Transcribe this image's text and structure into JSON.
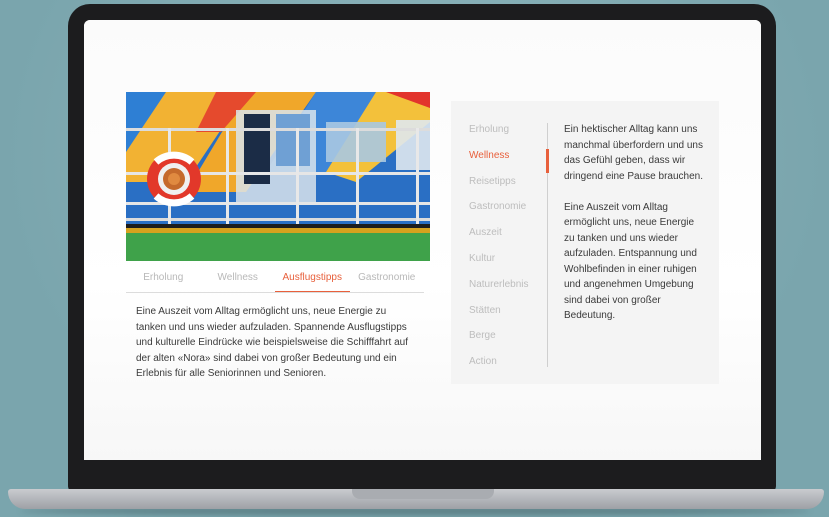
{
  "tabs": [
    "Erholung",
    "Wellness",
    "Ausflugstipps",
    "Gastronomie"
  ],
  "active_tab": "Ausflugstipps",
  "left_text": "Eine Auszeit vom Alltag ermöglicht uns, neue Energie zu tanken und uns wieder aufzuladen. Spannende Ausflugstipps und kulturelle Eindrücke wie beispielsweise die Schifffahrt auf der alten «Nora» sind dabei von großer Bedeutung und ein Erlebnis für alle Seniorinnen und Senioren.",
  "side_nav": [
    "Erholung",
    "Wellness",
    "Reisetipps",
    "Gastronomie",
    "Auszeit",
    "Kultur",
    "Naturerlebnis",
    "Stätten",
    "Berge",
    "Action"
  ],
  "active_side_item": "Wellness",
  "right_text": [
    "Ein hektischer Alltag kann uns manchmal überfordern und uns das Gefühl geben, dass wir dringend eine Pause brauchen.",
    "Eine Auszeit vom Alltag ermöglicht uns, neue Energie zu tanken und uns wieder aufzuladen. Entspannung und Wohlbefinden in einer ruhigen und angenehmen Umgebung sind dabei von großer Bedeutung."
  ],
  "colors": {
    "accent": "#e8603c",
    "panel": "#f4f4f4",
    "laptop": "#1c1c1e",
    "background": "#7fa9b0"
  }
}
